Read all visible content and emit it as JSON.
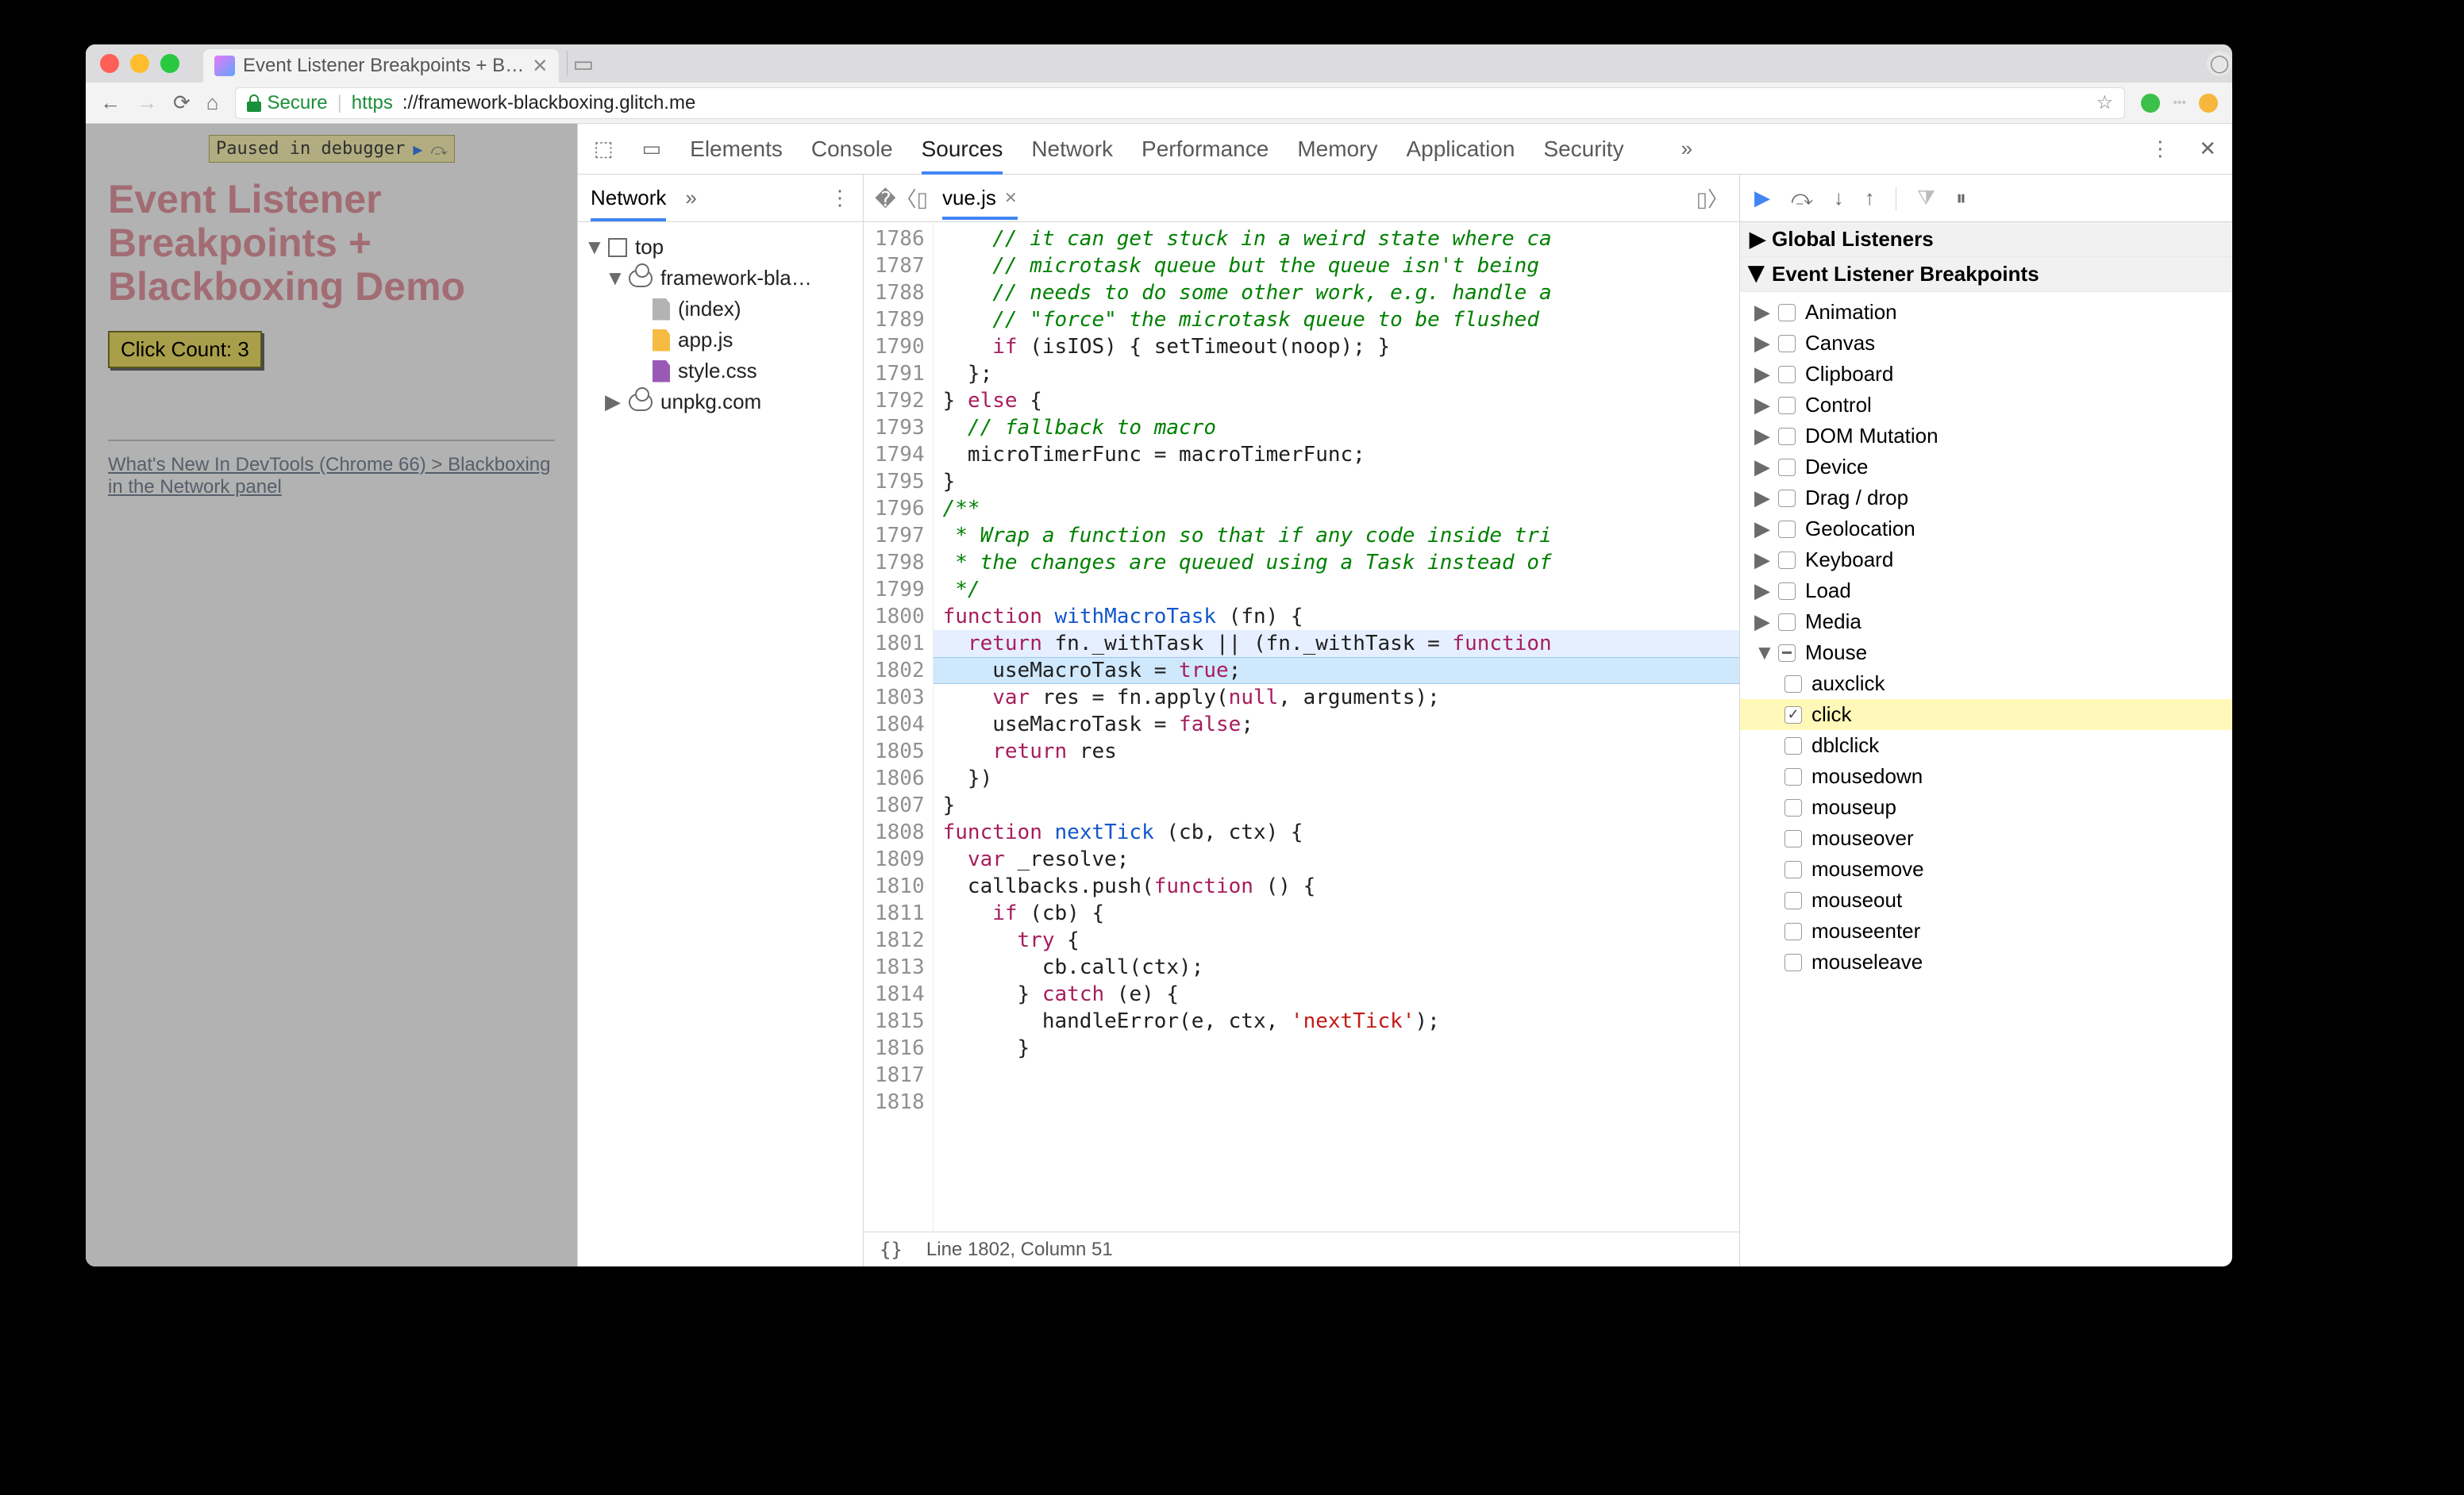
{
  "browser": {
    "tab_title": "Event Listener Breakpoints + B…",
    "secure_label": "Secure",
    "url_scheme": "https",
    "url_rest": "://framework-blackboxing.glitch.me"
  },
  "page_overlay": {
    "paused_label": "Paused in debugger"
  },
  "page_content": {
    "title_line1": "Event Listener",
    "title_line2": "Breakpoints +",
    "title_line3": "Blackboxing Demo",
    "button_label": "Click Count: 3",
    "link_text": "What's New In DevTools (Chrome 66) > Blackboxing in the Network panel"
  },
  "devtools_tabs": [
    "Elements",
    "Console",
    "Sources",
    "Network",
    "Performance",
    "Memory",
    "Application",
    "Security"
  ],
  "devtools_active_tab": "Sources",
  "nav": {
    "header": "Network",
    "tree": {
      "top": "top",
      "domain": "framework-bla…",
      "files": [
        "(index)",
        "app.js",
        "style.css"
      ],
      "cdn": "unpkg.com"
    }
  },
  "editor": {
    "filename": "vue.js",
    "status": "Line 1802, Column 51",
    "gutter_start": 1786,
    "gutter_end": 1818,
    "highlight_line": 1801,
    "exec_line": 1802,
    "lines": [
      {
        "c": "cgrn",
        "t": "    // it can get stuck in a weird state where ca"
      },
      {
        "c": "cgrn",
        "t": "    // microtask queue but the queue isn't being "
      },
      {
        "c": "cgrn",
        "t": "    // needs to do some other work, e.g. handle a"
      },
      {
        "c": "cgrn",
        "t": "    // \"force\" the microtask queue to be flushed "
      },
      {
        "raw": "    <span class='ckw'>if</span> (isIOS) { setTimeout(noop); }"
      },
      {
        "t": "  };"
      },
      {
        "raw": "} <span class='ckw'>else</span> {"
      },
      {
        "c": "cgrn",
        "t": "  // fallback to macro"
      },
      {
        "t": "  microTimerFunc = macroTimerFunc;"
      },
      {
        "t": "}"
      },
      {
        "t": ""
      },
      {
        "c": "cgrn",
        "t": "/**"
      },
      {
        "c": "cgrn",
        "t": " * Wrap a function so that if any code inside tri"
      },
      {
        "c": "cgrn",
        "t": " * the changes are queued using a Task instead of"
      },
      {
        "c": "cgrn",
        "t": " */"
      },
      {
        "raw": "<span class='ckw'>function</span> <span class='cbl'>withMacroTask</span> (fn) {"
      },
      {
        "raw": "  <span class='ckw'>return</span> fn._withTask || (fn._withTask = <span class='ckw'>function</span>"
      },
      {
        "raw": "    useMacroTask = <span class='ckw'>true</span>;"
      },
      {
        "raw": "    <span class='cvar'>var</span> res = fn.apply(<span class='ckw'>null</span>, arguments);"
      },
      {
        "raw": "    useMacroTask = <span class='ckw'>false</span>;"
      },
      {
        "raw": "    <span class='ckw'>return</span> res"
      },
      {
        "t": "  })"
      },
      {
        "t": "}"
      },
      {
        "t": ""
      },
      {
        "raw": "<span class='ckw'>function</span> <span class='cbl'>nextTick</span> (cb, ctx) {"
      },
      {
        "raw": "  <span class='cvar'>var</span> _resolve;"
      },
      {
        "raw": "  callbacks.push(<span class='ckw'>function</span> () {"
      },
      {
        "raw": "    <span class='ckw'>if</span> (cb) {"
      },
      {
        "raw": "      <span class='ckw'>try</span> {"
      },
      {
        "t": "        cb.call(ctx);"
      },
      {
        "raw": "      } <span class='ckw'>catch</span> (e) {"
      },
      {
        "raw": "        handleError(e, ctx, <span class='cstr'>'nextTick'</span>);"
      },
      {
        "t": "      }"
      }
    ]
  },
  "right_pane": {
    "sections": [
      {
        "title": "Global Listeners",
        "open": false
      },
      {
        "title": "Event Listener Breakpoints",
        "open": true
      }
    ],
    "categories": [
      {
        "name": "Animation"
      },
      {
        "name": "Canvas"
      },
      {
        "name": "Clipboard"
      },
      {
        "name": "Control"
      },
      {
        "name": "DOM Mutation"
      },
      {
        "name": "Device"
      },
      {
        "name": "Drag / drop"
      },
      {
        "name": "Geolocation"
      },
      {
        "name": "Keyboard"
      },
      {
        "name": "Load"
      },
      {
        "name": "Media"
      },
      {
        "name": "Mouse",
        "open": true,
        "mixed": true,
        "children": [
          {
            "name": "auxclick",
            "checked": false
          },
          {
            "name": "click",
            "checked": true
          },
          {
            "name": "dblclick",
            "checked": false
          },
          {
            "name": "mousedown",
            "checked": false
          },
          {
            "name": "mouseup",
            "checked": false
          },
          {
            "name": "mouseover",
            "checked": false
          },
          {
            "name": "mousemove",
            "checked": false
          },
          {
            "name": "mouseout",
            "checked": false
          },
          {
            "name": "mouseenter",
            "checked": false
          },
          {
            "name": "mouseleave",
            "checked": false
          }
        ]
      }
    ]
  }
}
